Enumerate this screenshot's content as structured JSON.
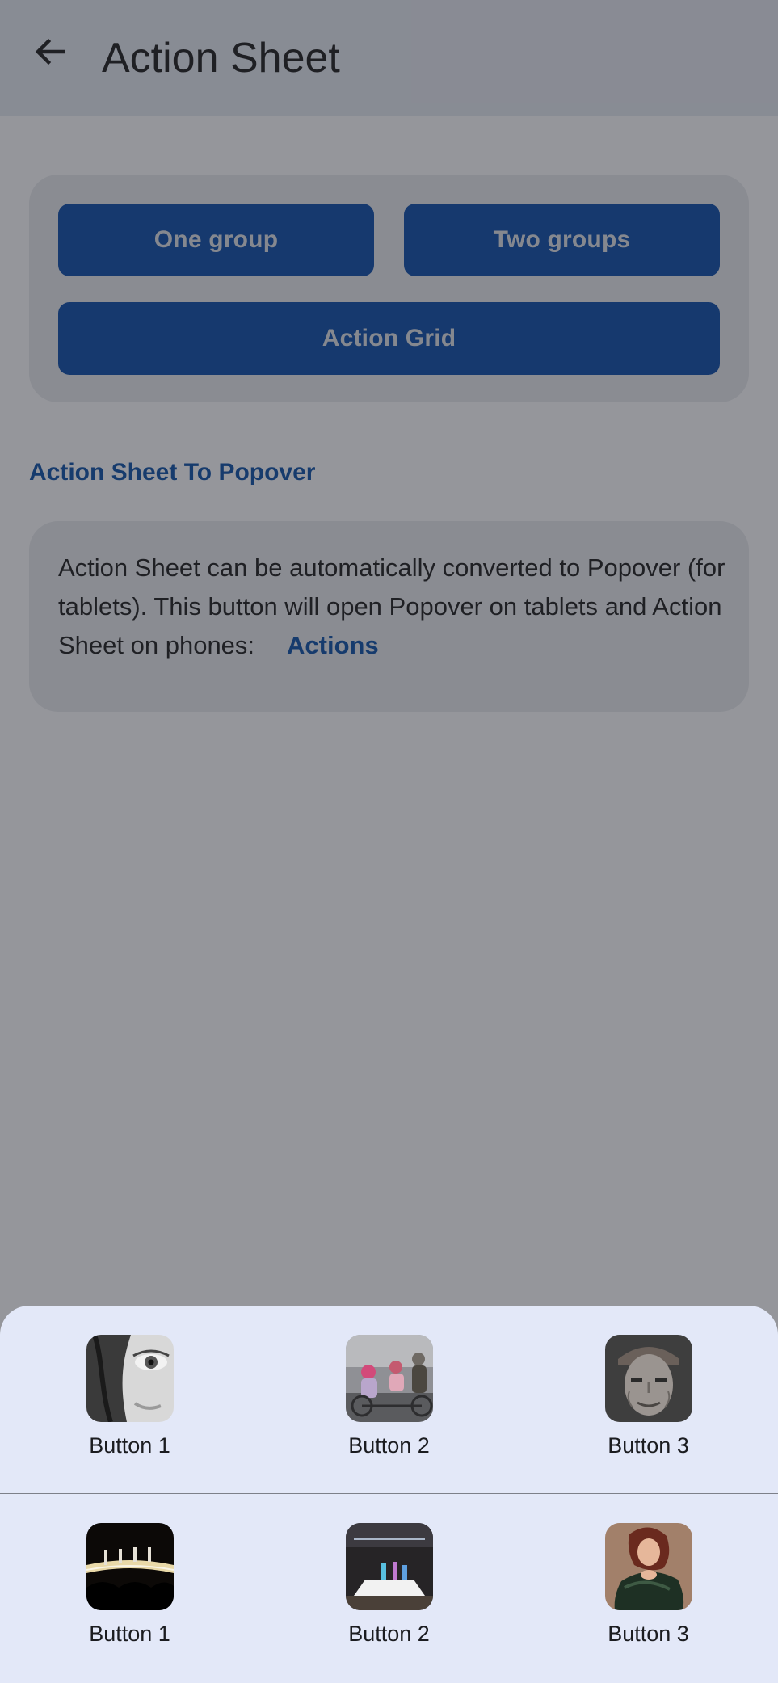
{
  "navbar": {
    "title": "Action Sheet",
    "back_icon": "arrow-left-icon"
  },
  "buttons_card": {
    "one_group": "One group",
    "two_groups": "Two groups",
    "action_grid": "Action Grid"
  },
  "popover_section": {
    "title": "Action Sheet To Popover",
    "description": "Action Sheet can be automatically converted to Popover (for tablets). This button will open Popover on tablets and Action Sheet on phones:",
    "link": "Actions"
  },
  "colors": {
    "primary": "#0a4aa8",
    "link": "#0b4ea6",
    "sheet_bg": "#e3e8f8"
  },
  "action_grid": {
    "groups": [
      {
        "items": [
          {
            "label": "Button 1",
            "image": "close-up-eye-photo"
          },
          {
            "label": "Button 2",
            "image": "people-on-bicycle-photo"
          },
          {
            "label": "Button 3",
            "image": "elderly-man-portrait-photo"
          }
        ]
      },
      {
        "items": [
          {
            "label": "Button 1",
            "image": "runway-show-photo"
          },
          {
            "label": "Button 2",
            "image": "stage-performance-photo"
          },
          {
            "label": "Button 3",
            "image": "woman-portrait-photo"
          }
        ]
      }
    ]
  }
}
